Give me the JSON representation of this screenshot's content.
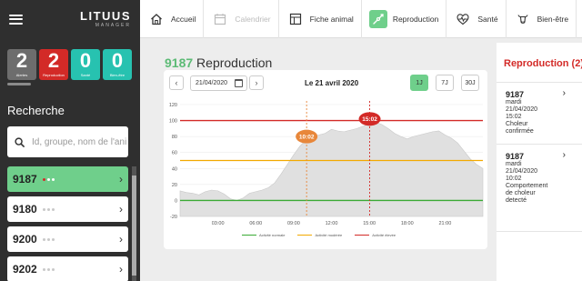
{
  "brand": {
    "name": "LITUUS",
    "sub": "MANAGER"
  },
  "counters": [
    {
      "value": "2",
      "label": "Alertes",
      "color": "#6d6d6d"
    },
    {
      "value": "2",
      "label": "Reproduction",
      "color": "#d32a27"
    },
    {
      "value": "0",
      "label": "Santé",
      "color": "#27c2b0"
    },
    {
      "value": "0",
      "label": "Bien-être",
      "color": "#27c2b0"
    }
  ],
  "search": {
    "title": "Recherche",
    "placeholder": "Id, groupe, nom de l'animal"
  },
  "animals": [
    {
      "id": "9187",
      "active": true
    },
    {
      "id": "9180",
      "active": false
    },
    {
      "id": "9200",
      "active": false
    },
    {
      "id": "9202",
      "active": false
    }
  ],
  "nav": [
    {
      "label": "Accueil",
      "icon": "home-icon"
    },
    {
      "label": "Calendrier",
      "icon": "calendar-icon",
      "disabled": true
    },
    {
      "label": "Fiche animal",
      "icon": "animal-card-icon"
    },
    {
      "label": "Reproduction",
      "icon": "reproduction-icon",
      "active": true
    },
    {
      "label": "Santé",
      "icon": "health-icon"
    },
    {
      "label": "Bien-être",
      "icon": "cow-icon"
    }
  ],
  "main": {
    "animal_id": "9187",
    "section": "Reproduction"
  },
  "controls": {
    "prev": "‹",
    "next": "›",
    "date": "21/04/2020",
    "day_label": "Le 21 avril 2020",
    "ranges": [
      "1J",
      "7J",
      "30J"
    ],
    "active_range": "1J"
  },
  "chart_data": {
    "type": "area",
    "x_ticks": [
      "03:00",
      "06:00",
      "09:00",
      "12:00",
      "15:00",
      "18:00",
      "21:00"
    ],
    "y_ticks": [
      -20,
      0,
      20,
      40,
      60,
      80,
      100,
      120
    ],
    "ylim": [
      -20,
      120
    ],
    "xlim_hours": [
      0,
      24
    ],
    "thresholds": [
      {
        "name": "Activité normale",
        "value": 0,
        "color": "#3aaa35"
      },
      {
        "name": "Activité modérée",
        "value": 50,
        "color": "#f2a900"
      },
      {
        "name": "Activité élevée",
        "value": 100,
        "color": "#d32a27"
      }
    ],
    "markers": [
      {
        "time": "10:02",
        "hour": 10.03,
        "color": "#e8873a",
        "level": 80
      },
      {
        "time": "15:02",
        "hour": 15.03,
        "color": "#d32a27",
        "level": 102
      }
    ],
    "series": [
      {
        "x": [
          0,
          0.5,
          1,
          1.5,
          2,
          2.5,
          3,
          3.5,
          4,
          4.5,
          5,
          5.5,
          6,
          6.5,
          7,
          7.5,
          8,
          8.5,
          9,
          9.5,
          10,
          10.5,
          11,
          11.5,
          12,
          12.5,
          13,
          13.5,
          14,
          14.5,
          15,
          15.5,
          16,
          16.5,
          17,
          17.5,
          18,
          18.5,
          19,
          19.5,
          20,
          20.5,
          21,
          21.5,
          22,
          22.5,
          23,
          23.5,
          24
        ],
        "values": [
          12,
          10,
          9,
          7,
          11,
          13,
          12,
          8,
          2,
          0,
          3,
          9,
          11,
          13,
          16,
          22,
          33,
          45,
          57,
          68,
          76,
          80,
          82,
          84,
          89,
          87,
          86,
          88,
          90,
          93,
          96,
          98,
          95,
          90,
          84,
          80,
          77,
          80,
          82,
          84,
          86,
          87,
          82,
          78,
          72,
          62,
          52,
          45,
          40
        ]
      }
    ],
    "fill_color": "#e0e0e0"
  },
  "right_panel": {
    "title": "Reproduction (2)",
    "items": [
      {
        "id": "9187",
        "day": "mardi",
        "date": "21/04/2020",
        "time": "15:02",
        "desc": [
          "Choleur",
          "confirmée"
        ]
      },
      {
        "id": "9187",
        "day": "mardi",
        "date": "21/04/2020",
        "time": "10:02",
        "desc": [
          "Comportement",
          "de choleur",
          "detecté"
        ]
      }
    ]
  }
}
